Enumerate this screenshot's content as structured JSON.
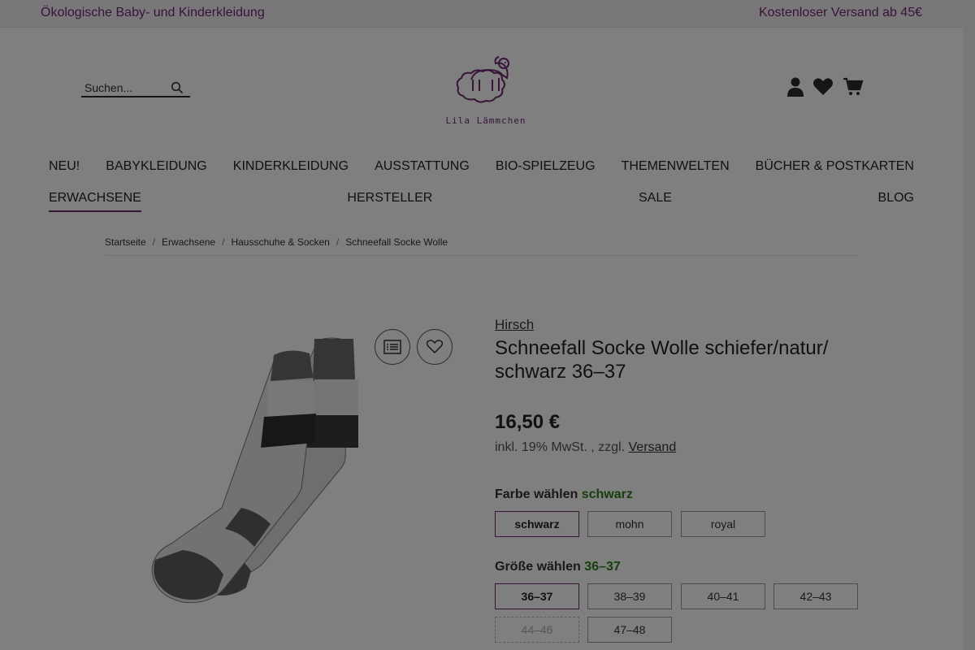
{
  "topbar": {
    "left_text": "Ökologische Baby- und Kinderkleidung",
    "right_text": "Kostenloser Versand ab 45€"
  },
  "search": {
    "placeholder": "Suchen..."
  },
  "logo": {
    "name": "Lila Lämmchen"
  },
  "header_icons": [
    "user-icon",
    "heart-icon",
    "cart-icon"
  ],
  "nav": {
    "row1": [
      "NEU!",
      "BABYKLEIDUNG",
      "KINDERKLEIDUNG",
      "AUSSTATTUNG",
      "BIO-SPIELZEUG",
      "THEMENWELTEN",
      "BÜCHER & POSTKARTEN"
    ],
    "row2": [
      "ERWACHSENE",
      "HERSTELLER",
      "SALE",
      "BLOG"
    ],
    "active": "ERWACHSENE"
  },
  "breadcrumb": [
    "Startseite",
    "Erwachsene",
    "Hausschuhe & Socken",
    "Schneefall Socke Wolle"
  ],
  "product": {
    "brand": "Hirsch",
    "title": "Schneefall Socke Wolle schiefer/natur/ schwarz 36–37",
    "price": "16,50 €",
    "tax_prefix": "inkl. 19% MwSt. , zzgl.",
    "shipping_link": "Versand",
    "color_label": "Farbe wählen",
    "color_selected": "schwarz",
    "colors": [
      "schwarz",
      "mohn",
      "royal"
    ],
    "size_label": "Größe wählen",
    "size_selected": "36–37",
    "sizes": [
      "36–37",
      "38–39",
      "40–41",
      "42–43",
      "44–46",
      "47–48"
    ],
    "sizes_disabled": [
      "44–46"
    ]
  },
  "colors": {
    "accent": "#6e2a73",
    "selected_value": "#2e7d1b",
    "overlay": "rgba(0,0,0,0.5)"
  }
}
